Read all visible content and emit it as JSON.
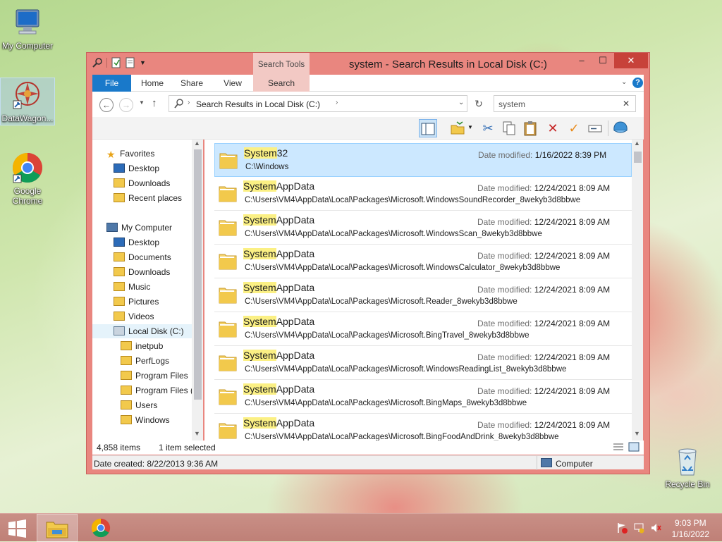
{
  "desktop": {
    "icons": [
      {
        "label": "My Computer"
      },
      {
        "label": "DataWagon..."
      },
      {
        "label": "Google Chrome"
      },
      {
        "label": "Recycle Bin"
      }
    ]
  },
  "window": {
    "title": "system - Search Results in Local Disk (C:)",
    "contextual_tab": "Search Tools",
    "tabs": [
      "File",
      "Home",
      "Share",
      "View",
      "Search"
    ],
    "address": "Search Results in Local Disk (C:)",
    "search_value": "system",
    "controls": {
      "minimize": "–",
      "maximize": "☐",
      "close": "✕"
    }
  },
  "navpane": {
    "favorites": {
      "label": "Favorites",
      "items": [
        "Desktop",
        "Downloads",
        "Recent places"
      ]
    },
    "computer": {
      "label": "My Computer",
      "items": [
        "Desktop",
        "Documents",
        "Downloads",
        "Music",
        "Pictures",
        "Videos",
        "Local Disk (C:)"
      ],
      "drive_children": [
        "inetpub",
        "PerfLogs",
        "Program Files",
        "Program Files (",
        "Users",
        "Windows"
      ]
    }
  },
  "results": {
    "date_label": "Date modified:",
    "rows": [
      {
        "match": "System",
        "rest": "32",
        "path": "C:\\Windows",
        "date": "1/16/2022 8:39 PM"
      },
      {
        "match": "System",
        "rest": "AppData",
        "path": "C:\\Users\\VM4\\AppData\\Local\\Packages\\Microsoft.WindowsSoundRecorder_8wekyb3d8bbwe",
        "date": "12/24/2021 8:09 AM"
      },
      {
        "match": "System",
        "rest": "AppData",
        "path": "C:\\Users\\VM4\\AppData\\Local\\Packages\\Microsoft.WindowsScan_8wekyb3d8bbwe",
        "date": "12/24/2021 8:09 AM"
      },
      {
        "match": "System",
        "rest": "AppData",
        "path": "C:\\Users\\VM4\\AppData\\Local\\Packages\\Microsoft.WindowsCalculator_8wekyb3d8bbwe",
        "date": "12/24/2021 8:09 AM"
      },
      {
        "match": "System",
        "rest": "AppData",
        "path": "C:\\Users\\VM4\\AppData\\Local\\Packages\\Microsoft.Reader_8wekyb3d8bbwe",
        "date": "12/24/2021 8:09 AM"
      },
      {
        "match": "System",
        "rest": "AppData",
        "path": "C:\\Users\\VM4\\AppData\\Local\\Packages\\Microsoft.BingTravel_8wekyb3d8bbwe",
        "date": "12/24/2021 8:09 AM"
      },
      {
        "match": "System",
        "rest": "AppData",
        "path": "C:\\Users\\VM4\\AppData\\Local\\Packages\\Microsoft.WindowsReadingList_8wekyb3d8bbwe",
        "date": "12/24/2021 8:09 AM"
      },
      {
        "match": "System",
        "rest": "AppData",
        "path": "C:\\Users\\VM4\\AppData\\Local\\Packages\\Microsoft.BingMaps_8wekyb3d8bbwe",
        "date": "12/24/2021 8:09 AM"
      },
      {
        "match": "System",
        "rest": "AppData",
        "path": "C:\\Users\\VM4\\AppData\\Local\\Packages\\Microsoft.BingFoodAndDrink_8wekyb3d8bbwe",
        "date": "12/24/2021 8:09 AM"
      }
    ]
  },
  "status": {
    "item_count": "4,858 items",
    "selection": "1 item selected",
    "date_created": "Date created: 8/22/2013 9:36 AM",
    "location": "Computer"
  },
  "taskbar": {
    "time": "9:03 PM",
    "date": "1/16/2022"
  },
  "colors": {
    "frame": "#e9867f",
    "accent": "#1979ca",
    "selection": "#cce8ff",
    "highlight": "#fbf084"
  }
}
